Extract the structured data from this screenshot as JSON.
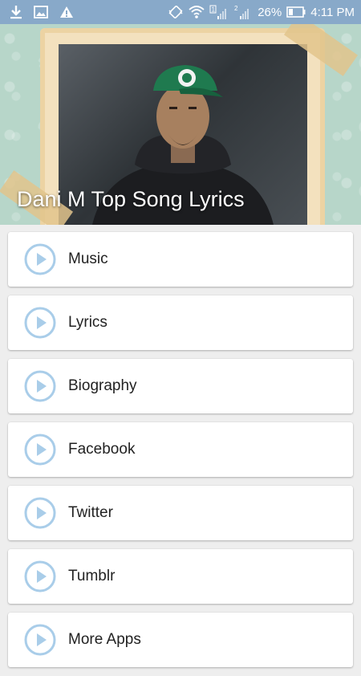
{
  "status_bar": {
    "battery_percent": "26%",
    "time": "4:11 PM",
    "sim1_label": "1",
    "sim2_label": "2",
    "icons": [
      "download-icon",
      "image-icon",
      "warning-icon",
      "vibrate-icon",
      "wifi-icon",
      "signal-icon",
      "battery-icon"
    ]
  },
  "header": {
    "title": "Dani M Top Song Lyrics",
    "background_color": "#b7d6c9"
  },
  "menu": {
    "items": [
      {
        "label": "Music"
      },
      {
        "label": "Lyrics"
      },
      {
        "label": "Biography"
      },
      {
        "label": "Facebook"
      },
      {
        "label": "Twitter"
      },
      {
        "label": "Tumblr"
      },
      {
        "label": "More Apps"
      }
    ],
    "icon": "play-circle-icon",
    "icon_color": "#a9cde9"
  }
}
